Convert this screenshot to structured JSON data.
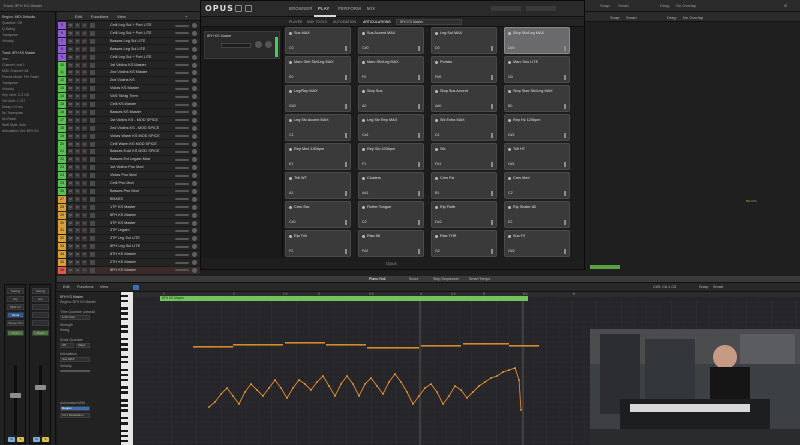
{
  "topbar": {
    "track_label": "Track: 8FH KS Master",
    "right_items": [
      "Snap:",
      "Smart",
      "Drag:",
      "No Overlap"
    ]
  },
  "inspector": {
    "rows": [
      {
        "label": "Region: MIDI Defaults",
        "hdr": true
      },
      {
        "label": "Quantize: Off",
        "hdr": false
      },
      {
        "label": "Q-Swing",
        "hdr": false
      },
      {
        "label": "Transpose",
        "hdr": false
      },
      {
        "label": "Velocity",
        "hdr": false
      },
      {
        "label": "",
        "hdr": false
      },
      {
        "label": "Track: 8FH KS Master",
        "hdr": true
      },
      {
        "label": "Icon",
        "hdr": false
      },
      {
        "label": "Channel: Inst 1",
        "hdr": false
      },
      {
        "label": "MIDI Channel: All",
        "hdr": false
      },
      {
        "label": "Freeze Mode: Pre Fader",
        "hdr": false
      },
      {
        "label": "Transpose",
        "hdr": false
      },
      {
        "label": "Velocity",
        "hdr": false
      },
      {
        "label": "Key Limit: C-2 G8",
        "hdr": false
      },
      {
        "label": "Vel Limit: 1 127",
        "hdr": false
      },
      {
        "label": "Delay: 0.0 ms",
        "hdr": false
      },
      {
        "label": "No Transpose",
        "hdr": false
      },
      {
        "label": "No Reset",
        "hdr": false
      },
      {
        "label": "Staff Style: Auto",
        "hdr": false
      },
      {
        "label": "Articulation Set: 8FH KS",
        "hdr": false
      }
    ],
    "strip_left": {
      "slot1": "Setting",
      "slot2": "EQ",
      "slot3": "MIDI FX",
      "slot4": "Opus",
      "slot5": "Stereo Out",
      "read": "Read",
      "bus": "Bnce",
      "m": "M",
      "s": "S",
      "name": "8FH KS Master"
    },
    "strip_right": {
      "slot1": "Setting",
      "slot2": "EQ",
      "slot3": "",
      "slot4": "",
      "slot5": "",
      "read": "Read",
      "bus": "Bnce",
      "m": "M",
      "s": "S",
      "name": "Stereo Out"
    }
  },
  "tracks_toolbar": {
    "edit": "Edit",
    "functions": "Functions",
    "view": "View"
  },
  "tracks": [
    {
      "num": "5",
      "name": "Celli Leg Sul + Port LITE",
      "color": "#8e5ad6"
    },
    {
      "num": "6",
      "name": "Celli Leg Sul + Port LITE",
      "color": "#8e5ad6"
    },
    {
      "num": "7",
      "name": "Basses Leg Sul LITE",
      "color": "#8e5ad6"
    },
    {
      "num": "8",
      "name": "Basses Leg Sul LITE",
      "color": "#8e5ad6"
    },
    {
      "num": "9",
      "name": "Celli Leg Sul + Port LITE",
      "color": "#8e5ad6"
    },
    {
      "num": "10",
      "name": "1st Violins KS Master",
      "color": "#56c34f"
    },
    {
      "num": "11",
      "name": "2nd Violins KS Master",
      "color": "#56c34f"
    },
    {
      "num": "12",
      "name": "2nd Violins KS",
      "color": "#56c34f"
    },
    {
      "num": "13",
      "name": "Violas KS Master",
      "color": "#56c34f"
    },
    {
      "num": "14",
      "name": "VAS Sfzdg Trem",
      "color": "#56c34f"
    },
    {
      "num": "15",
      "name": "Celli KS Master",
      "color": "#56c34f"
    },
    {
      "num": "16",
      "name": "Basses KS Master",
      "color": "#56c34f"
    },
    {
      "num": "17",
      "name": "1st Violins KS - MOD SPICE",
      "color": "#56c34f"
    },
    {
      "num": "18",
      "name": "2nd Violins KS - MOD SPICE",
      "color": "#56c34f"
    },
    {
      "num": "19",
      "name": "Violas Warm KS MOD SPICE",
      "color": "#56c34f"
    },
    {
      "num": "20",
      "name": "Celli Warm KS MOD SPICE",
      "color": "#56c34f"
    },
    {
      "num": "21",
      "name": "Basses Extd KS MOD SPICE",
      "color": "#56c34f"
    },
    {
      "num": "22",
      "name": "Basses Ext Legato Mod",
      "color": "#56c34f"
    },
    {
      "num": "23",
      "name": "1st Violins Pno Mod",
      "color": "#56c34f"
    },
    {
      "num": "24",
      "name": "Violas Pno Mod",
      "color": "#56c34f"
    },
    {
      "num": "25",
      "name": "Celli Pno Mod",
      "color": "#56c34f"
    },
    {
      "num": "26",
      "name": "Basses Pno Mod",
      "color": "#56c34f"
    },
    {
      "num": "27",
      "name": "BRASS",
      "color": "#d9a03a"
    },
    {
      "num": "28",
      "name": "1TP KS Master",
      "color": "#d9a03a"
    },
    {
      "num": "29",
      "name": "8FH KS Master",
      "color": "#d9a03a"
    },
    {
      "num": "30",
      "name": "3TP KS Master",
      "color": "#d9a03a"
    },
    {
      "num": "31",
      "name": "3TP Legato",
      "color": "#d9a03a"
    },
    {
      "num": "32",
      "name": "3TP Leg Sul LITE",
      "color": "#d9a03a"
    },
    {
      "num": "33",
      "name": "8FH Leg Sul LITE",
      "color": "#d9a03a"
    },
    {
      "num": "34",
      "name": "8TH KS Master",
      "color": "#d9a03a"
    },
    {
      "num": "35",
      "name": "2TH KS Master",
      "color": "#d9a03a"
    },
    {
      "num": "36",
      "name": "8FH KS Master",
      "color": "#e3574a"
    }
  ],
  "workspace": {
    "snap": "Snap:",
    "snap_val": "Smart",
    "drag": "Drag:",
    "drag_val": "No Overlap",
    "region_label": "8FH KS"
  },
  "opus": {
    "logo": "OPUS",
    "tabs": [
      "BROWSER",
      "PLAY",
      "PERFORM",
      "MIX"
    ],
    "active_tab": "PLAY",
    "subtabs": [
      "PLAYER",
      "MIDI TOOLS",
      "AUTOMATION",
      "ARTICULATIONS"
    ],
    "active_subtab": "ARTICULATIONS",
    "instrument": "8FH KS Master",
    "instrument_short": "8FH KS Master",
    "footer": "Opus",
    "pads": [
      {
        "name": "Sus MAX",
        "key": "C0",
        "sel": false
      },
      {
        "name": "Sus Accent MAX",
        "key": "C#0",
        "sel": false
      },
      {
        "name": "Leg Sul MAX",
        "key": "D0",
        "sel": false
      },
      {
        "name": "Stop Sfz/Leg MAX",
        "key": "D#0",
        "sel": true
      },
      {
        "name": "Marc Shrt Sfz/Leg MAX",
        "key": "E0",
        "sel": false
      },
      {
        "name": "Marc Sfz/Leg MAX",
        "key": "F0",
        "sel": false
      },
      {
        "name": "Portato",
        "key": "F#0",
        "sel": false
      },
      {
        "name": "Marc Sus LITE",
        "key": "G0",
        "sel": false
      },
      {
        "name": "Leg/Rep MAX",
        "key": "G#0",
        "sel": false
      },
      {
        "name": "Stop Sus",
        "key": "A0",
        "sel": false
      },
      {
        "name": "Stop Sus Accent",
        "key": "A#0",
        "sel": false
      },
      {
        "name": "Stop Stac Sfz/Leg MAX",
        "key": "B0",
        "sel": false
      },
      {
        "name": "Leg Sfz Accent MAX",
        "key": "C1",
        "sel": false
      },
      {
        "name": "Leg Sfz Rep MAX",
        "key": "C#1",
        "sel": false
      },
      {
        "name": "Sfz Extra MAX",
        "key": "D1",
        "sel": false
      },
      {
        "name": "Rep Hz 120bpm",
        "key": "D#1",
        "sel": false
      },
      {
        "name": "Rep Med 140bpm",
        "key": "E1",
        "sel": false
      },
      {
        "name": "Rep Stc 100bpm",
        "key": "F1",
        "sel": false
      },
      {
        "name": "Sfz",
        "key": "F#1",
        "sel": false
      },
      {
        "name": "Trill HT",
        "key": "G#1",
        "sel": false
      },
      {
        "name": "Trill WT",
        "key": "A1",
        "sel": false
      },
      {
        "name": "Clusters",
        "key": "A#1",
        "sel": false
      },
      {
        "name": "Cres Fst",
        "key": "B1",
        "sel": false
      },
      {
        "name": "Cres Med",
        "key": "C2",
        "sel": false
      },
      {
        "name": "Cres Slw",
        "key": "C#2",
        "sel": false
      },
      {
        "name": "Flutter Tongue",
        "key": "D2",
        "sel": false
      },
      {
        "name": "Rip Fluttr",
        "key": "D#2",
        "sel": false
      },
      {
        "name": "Rip Shake 88",
        "key": "E2",
        "sel": false
      },
      {
        "name": "Rip Trill",
        "key": "F2",
        "sel": false
      },
      {
        "name": "Rise 88",
        "key": "F#2",
        "sel": false
      },
      {
        "name": "Rise THR",
        "key": "G2",
        "sel": false
      },
      {
        "name": "Sus FX",
        "key": "G#2",
        "sel": false
      }
    ]
  },
  "piano_roll": {
    "header_tabs": [
      "Piano Roll",
      "Score",
      "Step Sequencer",
      "Smart Tempo"
    ],
    "active_header": "Piano Roll",
    "toolbar": [
      "Edit",
      "Functions",
      "View"
    ],
    "region_name": "8FH KS Master",
    "insp": {
      "title": "8FH KS Master",
      "sub": "Region: 8FH KS Master",
      "time_q": "Time Quantize (classic)",
      "q_val": "1/16 Note",
      "strength": "Strength",
      "swing": "Swing",
      "scale_q": "Scale Quantize",
      "scale_off": "Off",
      "scale_major": "Major",
      "artic": "Articulation",
      "artic_val": "Sus MAX",
      "velocity": "Velocity",
      "automation": "Automation/MIDI",
      "auto_val": "Region",
      "auto_cc": "CC1 Modulation"
    },
    "ruler": [
      "1",
      "2",
      "2.3",
      "3",
      "3.3",
      "4",
      "4.3",
      "5",
      "5.3",
      "6"
    ],
    "right_bar": {
      "pos": "C#3: C#-1 C5",
      "snap": "Snap:",
      "snap_val": "Smart"
    }
  },
  "colors": {
    "accent_green": "#74c25b",
    "automation": "#e08a2b",
    "selected_pad": "#6a6a6c"
  }
}
